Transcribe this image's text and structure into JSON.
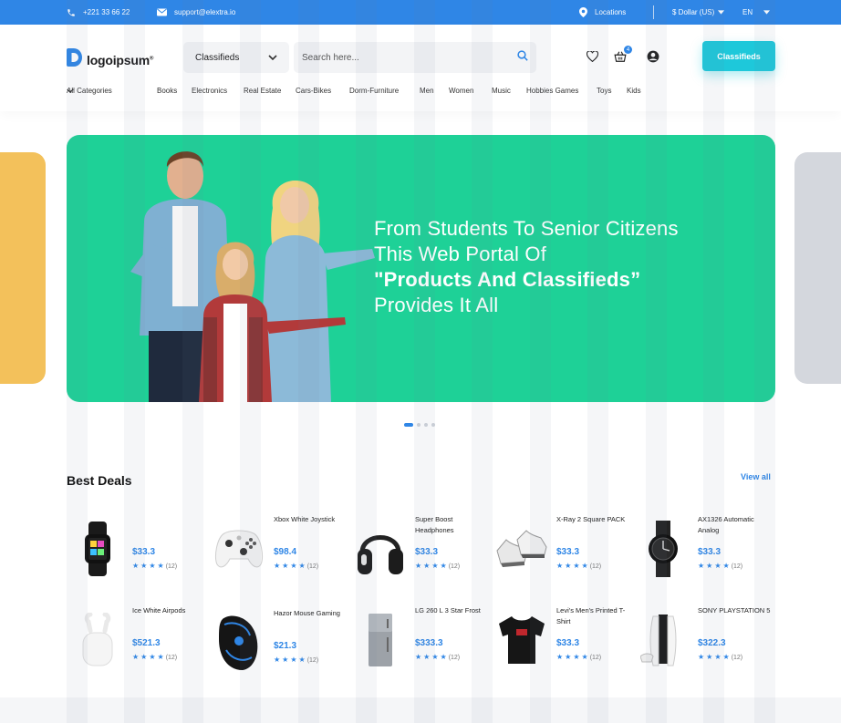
{
  "topbar": {
    "phone": "+221 33 66 22",
    "email": "support@elextra.io",
    "locations": "Locations",
    "currency": "$ Dollar (US)",
    "language": "EN"
  },
  "header": {
    "logo_text": "logoipsum",
    "logo_mark": "®",
    "category_select": "Classifieds",
    "search_placeholder": "Search here...",
    "cart_count": "4",
    "classifieds_button": "Classifieds"
  },
  "nav": {
    "all_categories": "All Categories",
    "items": [
      "Books",
      "Electronics",
      "Real Estate",
      "Cars-Bikes",
      "Dorm-Furniture",
      "Men",
      "Women",
      "Music",
      "Hobbies Games",
      "Toys",
      "Kids"
    ]
  },
  "hero": {
    "line1": "From Students To Senior Citizens",
    "line2": "This Web Portal Of",
    "line3": "\"Products And Classifieds”",
    "line4": "Provides It All",
    "slides": 4,
    "active_slide": 1
  },
  "deals": {
    "title": "Best Deals",
    "view_all": "View all",
    "products": [
      {
        "name": "",
        "price": "$33.3",
        "reviews": "(12)",
        "icon": "smartwatch-band-icon"
      },
      {
        "name": "Xbox White Joystick",
        "price": "$98.4",
        "reviews": "(12)",
        "icon": "game-controller-icon"
      },
      {
        "name": "Super Boost Headphones",
        "price": "$33.3",
        "reviews": "(12)",
        "icon": "headphones-icon"
      },
      {
        "name": "X-Ray 2 Square PACK",
        "price": "$33.3",
        "reviews": "(12)",
        "icon": "sneakers-icon"
      },
      {
        "name": "AX1326 Automatic Analog",
        "price": "$33.3",
        "reviews": "(12)",
        "icon": "wristwatch-icon"
      },
      {
        "name": "Ice White Airpods",
        "price": "$521.3",
        "reviews": "(12)",
        "icon": "airpods-icon"
      },
      {
        "name": "Hazor Mouse Gaming",
        "price": "$21.3",
        "reviews": "(12)",
        "icon": "gaming-mouse-icon"
      },
      {
        "name": "LG 260 L 3 Star Frost",
        "price": "$333.3",
        "reviews": "(12)",
        "icon": "refrigerator-icon"
      },
      {
        "name": "Levi's Men's Printed T-Shirt",
        "price": "$33.3",
        "reviews": "(12)",
        "icon": "tshirt-icon"
      },
      {
        "name": "SONY PLAYSTATION 5",
        "price": "$322.3",
        "reviews": "(12)",
        "icon": "game-console-icon"
      }
    ]
  },
  "colors": {
    "brand_blue": "#2f86e6",
    "hero_green": "#1ed197",
    "cta_cyan": "#1ec8da",
    "side_yellow": "#f3c15b",
    "side_gray": "#d4d7dd"
  }
}
